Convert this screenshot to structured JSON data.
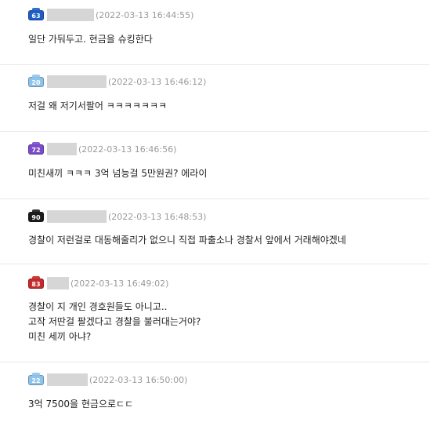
{
  "comments": [
    {
      "badge": {
        "level": "63",
        "color": "#1e5ec4"
      },
      "date": "(2022-03-13 16:44:55)",
      "lines": [
        "일단 가둬두고. 현금을 슈킹한다"
      ]
    },
    {
      "badge": {
        "level": "20",
        "color": "#8ec3ea"
      },
      "date": "(2022-03-13 16:46:12)",
      "lines": [
        "저걸 왜 저기서팔어 ㅋㅋㅋㅋㅋㅋㅋ"
      ]
    },
    {
      "badge": {
        "level": "72",
        "color": "#7b4bc8"
      },
      "date": "(2022-03-13 16:46:56)",
      "lines": [
        "미친새끼 ㅋㅋㅋ 3억 넘능걸 5만원권? 에라이"
      ]
    },
    {
      "badge": {
        "level": "90",
        "color": "#1c1c1c"
      },
      "date": "(2022-03-13 16:48:53)",
      "lines": [
        "경찰이 저런걸로 대동해줄리가 없으니 직접 파출소나 경찰서 앞에서 거래해야겠네"
      ]
    },
    {
      "badge": {
        "level": "83",
        "color": "#c42a2a"
      },
      "date": "(2022-03-13 16:49:02)",
      "lines": [
        "경찰이 지 개인 경호원들도 아니고..",
        "고작 저딴걸 팔겠다고 경찰을 불러대는거야?",
        "미친 세끼 아냐?"
      ]
    },
    {
      "badge": {
        "level": "22",
        "color": "#8ec3ea"
      },
      "date": "(2022-03-13 16:50:00)",
      "lines": [
        "3억 7500을 현금으로ㄷㄷ"
      ]
    }
  ]
}
